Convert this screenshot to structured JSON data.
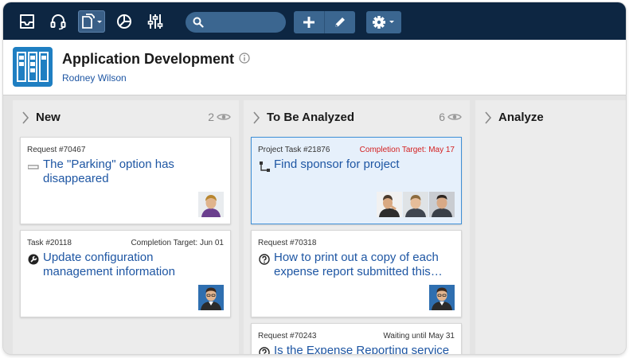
{
  "toolbar": {
    "icons": [
      "inbox-icon",
      "headset-icon",
      "documents-icon",
      "pie-chart-icon",
      "sliders-icon"
    ],
    "search": {
      "value": "",
      "placeholder": ""
    },
    "actions": [
      "add-icon",
      "edit-icon"
    ],
    "settings": "gear-icon"
  },
  "header": {
    "title": "Application Development",
    "owner": "Rodney Wilson"
  },
  "columns": [
    {
      "title": "New",
      "count": "2",
      "cards": [
        {
          "type": "Request #70467",
          "meta": "",
          "title": "The \"Parking\" option has disappeared",
          "icon": "dash-icon"
        },
        {
          "type": "Task #20118",
          "meta": "Completion Target: Jun 01",
          "title": "Update configuration management information",
          "icon": "wrench-icon"
        }
      ]
    },
    {
      "title": "To Be Analyzed",
      "count": "6",
      "cards": [
        {
          "type": "Project Task #21876",
          "meta": "Completion Target: May 17",
          "title": "Find sponsor for project",
          "icon": "hierarchy-icon"
        },
        {
          "type": "Request #70318",
          "meta": "",
          "title": "How to print out a copy of each expense report submitted this…",
          "icon": "question-icon"
        },
        {
          "type": "Request #70243",
          "meta": "Waiting until May 31",
          "title": "Is the Expense Reporting service",
          "icon": "question-icon"
        }
      ]
    },
    {
      "title": "Analyze",
      "count": "",
      "cards": []
    }
  ],
  "colors": {
    "toolbar": "#0d2642",
    "link": "#1e56a3",
    "overdue": "#d42020",
    "selected": "#e6f0fb"
  }
}
